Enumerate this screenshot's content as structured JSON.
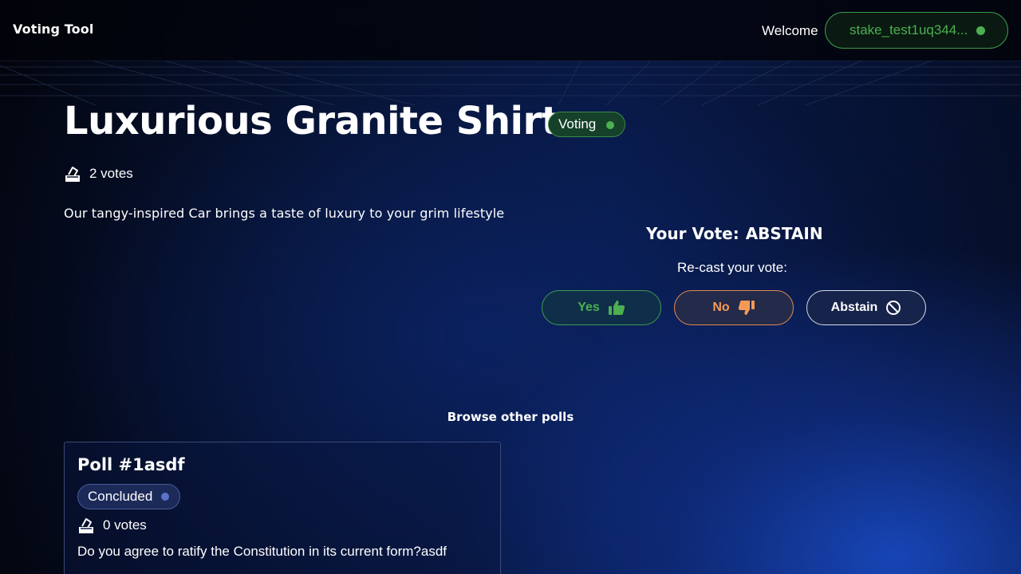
{
  "header": {
    "brand": "Voting Tool",
    "welcome": "Welcome",
    "stake_address": "stake_test1uq344...",
    "status_color": "#4caf50"
  },
  "poll": {
    "title": "Luxurious Granite Shirt",
    "status": "Voting",
    "votes": "2 votes",
    "votes_icon": "ballot-box-icon",
    "description": "Our tangy-inspired Car brings a taste of luxury to your grim lifestyle"
  },
  "vote_panel": {
    "your_vote_label": "Your Vote:",
    "your_vote_value": "ABSTAIN",
    "recast_label": "Re-cast your vote:",
    "buttons": [
      {
        "label": "Yes",
        "icon": "thumbs-up-icon",
        "color": "#4caf50"
      },
      {
        "label": "No",
        "icon": "thumbs-down-icon",
        "color": "#f59a55"
      },
      {
        "label": "Abstain",
        "icon": "prohibited-icon",
        "color": "#ffffff"
      }
    ]
  },
  "browse": {
    "heading": "Browse other polls",
    "polls": [
      {
        "title": "Poll #1asdf",
        "status": "Concluded",
        "votes": "0 votes",
        "description": "Do you agree to ratify the Constitution in its current form?asdf"
      }
    ]
  }
}
